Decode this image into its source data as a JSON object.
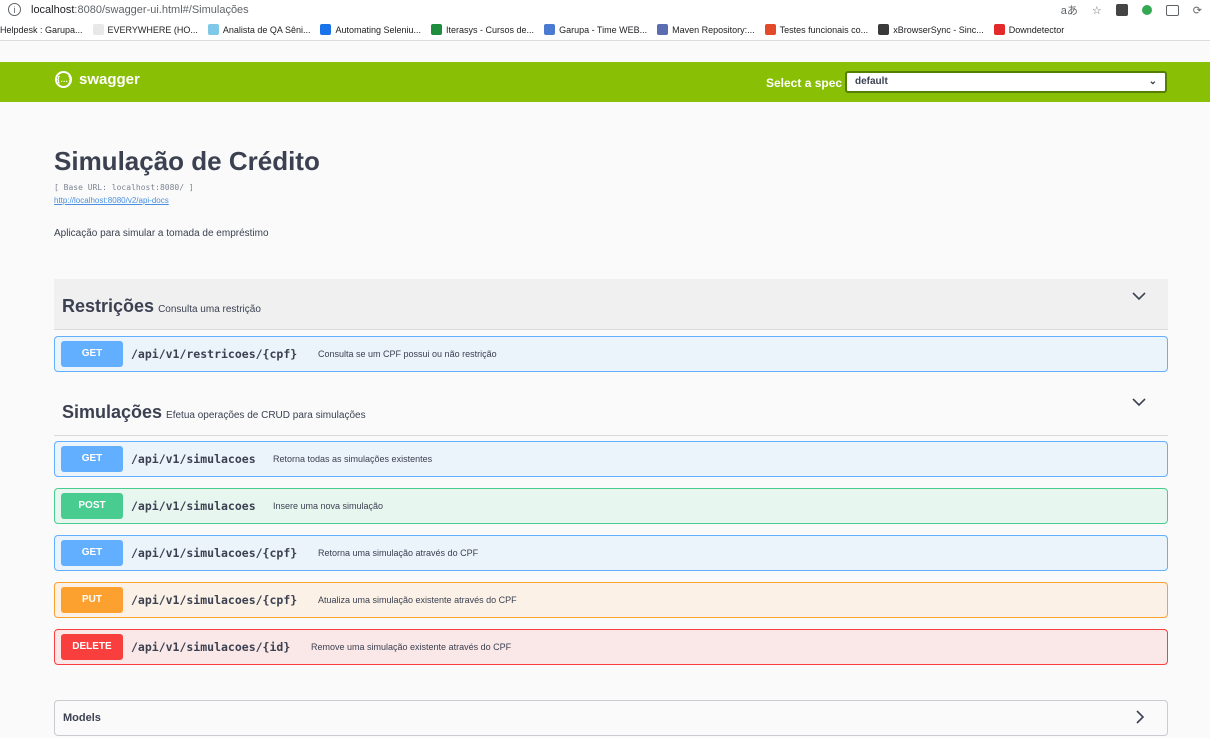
{
  "browser": {
    "url_host": "localhost",
    "url_rest": ":8080/swagger-ui.html#/Simulações",
    "info_icon": "info-icon",
    "bookmarks": [
      {
        "label": "Helpdesk : Garupa...",
        "color": "#ffffff"
      },
      {
        "label": "EVERYWHERE (HO...",
        "color": "#e8e8e8"
      },
      {
        "label": "Analista de QA Sêni...",
        "color": "#7fc8e8"
      },
      {
        "label": "Automating Seleniu...",
        "color": "#1a73e8"
      },
      {
        "label": "Iterasys - Cursos de...",
        "color": "#1e8e3e"
      },
      {
        "label": "Garupa - Time WEB...",
        "color": "#4a7bd0"
      },
      {
        "label": "Maven Repository:...",
        "color": "#5b6cb0"
      },
      {
        "label": "Testes funcionais co...",
        "color": "#e24a2a"
      },
      {
        "label": "xBrowserSync - Sinc...",
        "color": "#3a3a3a"
      },
      {
        "label": "Downdetector",
        "color": "#e22a2a"
      }
    ]
  },
  "topbar": {
    "logo": "swagger",
    "spec_label": "Select a spec",
    "spec_value": "default"
  },
  "info": {
    "title": "Simulação de Crédito",
    "base_url": "[ Base URL: localhost:8080/ ]",
    "api_docs_link": "http://localhost:8080/v2/api-docs",
    "description": "Aplicação para simular a tomada de empréstimo"
  },
  "tags": [
    {
      "name": "Restrições",
      "description": "Consulta uma restrição",
      "operations": [
        {
          "method": "GET",
          "path": "/api/v1/restricoes/{cpf}",
          "summary": "Consulta se um CPF possui ou não restrição"
        }
      ]
    },
    {
      "name": "Simulações",
      "description": "Efetua operações de CRUD para simulações",
      "operations": [
        {
          "method": "GET",
          "path": "/api/v1/simulacoes",
          "summary": "Retorna todas as simulações existentes"
        },
        {
          "method": "POST",
          "path": "/api/v1/simulacoes",
          "summary": "Insere uma nova simulação"
        },
        {
          "method": "GET",
          "path": "/api/v1/simulacoes/{cpf}",
          "summary": "Retorna uma simulação através do CPF"
        },
        {
          "method": "PUT",
          "path": "/api/v1/simulacoes/{cpf}",
          "summary": "Atualiza uma simulação existente através do CPF"
        },
        {
          "method": "DELETE",
          "path": "/api/v1/simulacoes/{id}",
          "summary": "Remove uma simulação existente através do CPF"
        }
      ]
    }
  ],
  "models": {
    "label": "Models"
  },
  "colors": {
    "topbar": "#89bf04",
    "get": "#61affe",
    "post": "#49cc90",
    "put": "#fca130",
    "delete": "#f93e3e"
  }
}
